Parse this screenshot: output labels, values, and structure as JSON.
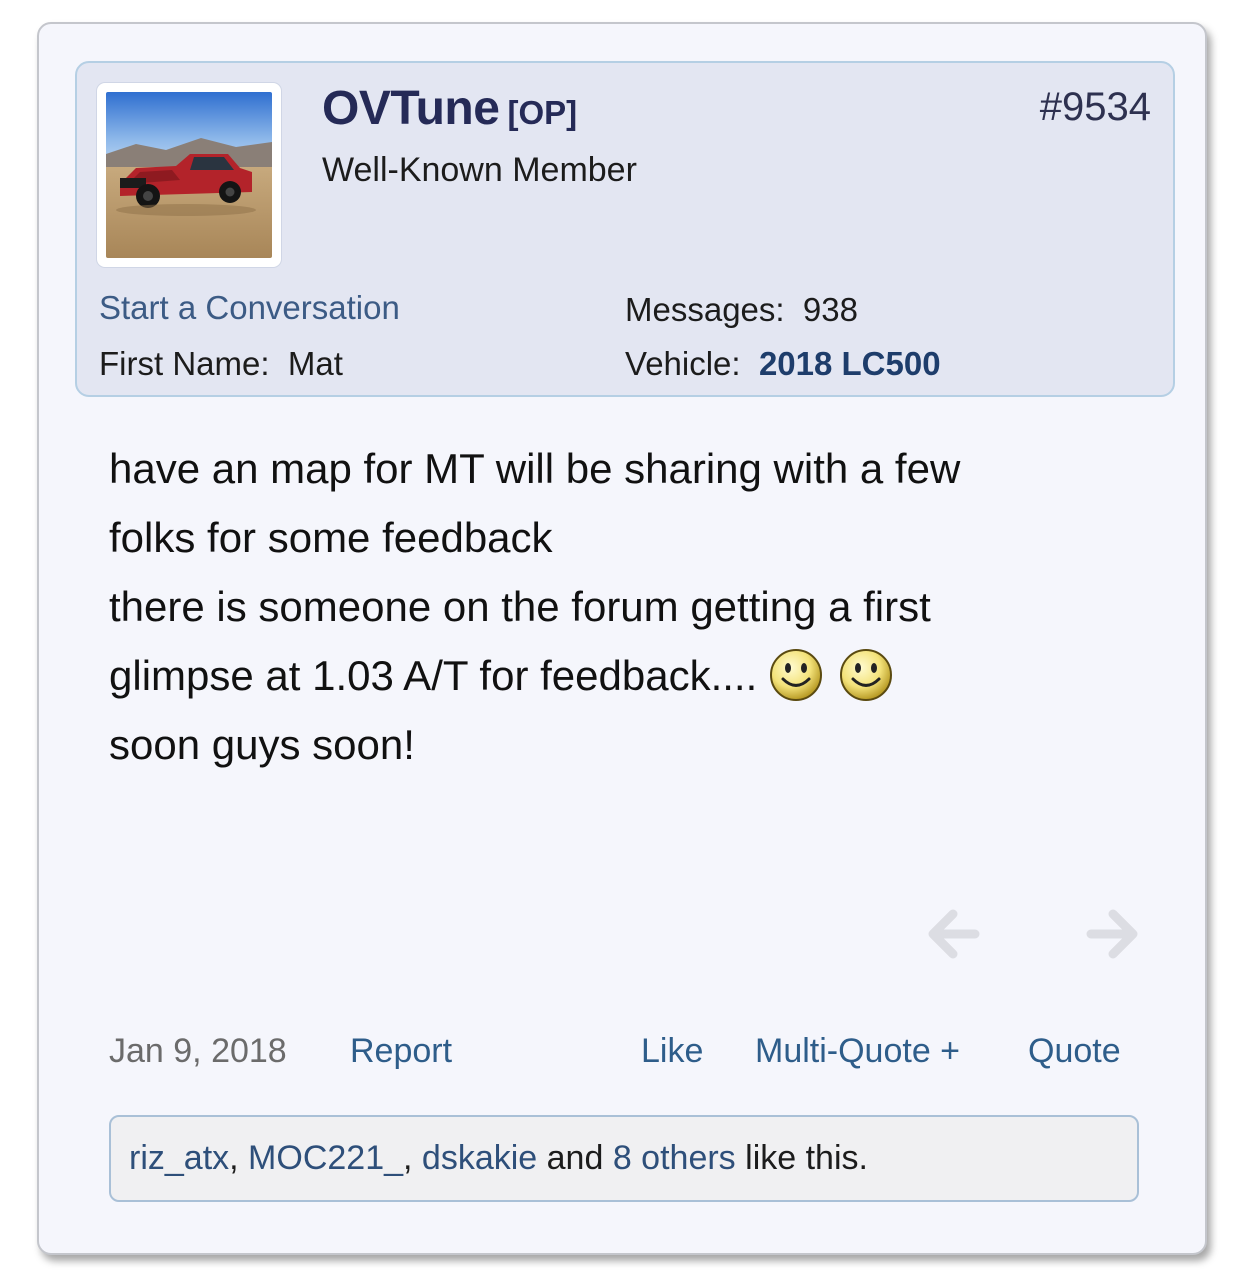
{
  "post": {
    "number": "#9534",
    "author": {
      "username": "OVTune",
      "op_badge": "[OP]",
      "title": "Well-Known Member",
      "start_conversation_label": "Start a Conversation",
      "first_name_label": "First Name:",
      "first_name": "Mat",
      "messages_label": "Messages:",
      "messages": "938",
      "vehicle_label": "Vehicle:",
      "vehicle": "2018 LC500"
    },
    "body": {
      "line1": "have an map for MT will be sharing with a few",
      "line2": "folks for some feedback",
      "line3": "there is someone on the forum getting a first",
      "line4": "glimpse at 1.03 A/T for feedback....",
      "line5": "soon guys soon!"
    },
    "date": "Jan 9, 2018",
    "actions": {
      "report": "Report",
      "like": "Like",
      "multi_quote": "Multi-Quote +",
      "quote": "Quote"
    },
    "likes": {
      "user1": "riz_atx",
      "sep1": ", ",
      "user2": "MOC221_",
      "sep2": ", ",
      "user3": "dskakie",
      "and_text": " and ",
      "others": "8 others",
      "suffix": " like this."
    }
  },
  "icons": {
    "smiley": "smiley-icon",
    "prev": "arrow-left-icon",
    "next": "arrow-right-icon"
  },
  "colors": {
    "username": "#252a57",
    "link": "#2e5d8a",
    "card_bg": "#f5f6fc",
    "user_block_bg": "#e3e6f2"
  }
}
